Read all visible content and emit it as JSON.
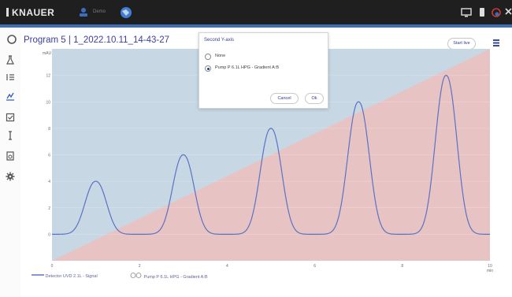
{
  "app": {
    "brand": "KNAUER",
    "user_label": "Demo"
  },
  "page": {
    "title": "Program 5 | 1_2022.10.11_14-43-27"
  },
  "toolbar": {
    "start_label": "Start live"
  },
  "dialog": {
    "title": "Second Y-axis",
    "options": [
      {
        "label": "None",
        "selected": false
      },
      {
        "label": "Pump P 6.1L HPG - Gradient A:B",
        "selected": true
      }
    ],
    "cancel_label": "Cancel",
    "ok_label": "Ok"
  },
  "legend": {
    "items": [
      {
        "label": "Detector UVD 2.1L - Signal",
        "color": "#5a72c4"
      },
      {
        "label": "Pump P 6.1L HPG - Gradient A:B",
        "color": "#e4b4b4"
      }
    ]
  },
  "chart_data": {
    "type": "line",
    "xunit": "min",
    "yunit": "mAU",
    "xlim": [
      0,
      10
    ],
    "ylim": [
      -2,
      14
    ],
    "xticks": [
      0,
      2,
      4,
      6,
      8,
      10
    ],
    "yticks": [
      0,
      2,
      4,
      6,
      8,
      10,
      12
    ],
    "series": [
      {
        "name": "Detector UVD 2.1L - Signal",
        "peaks": [
          {
            "center": 1.0,
            "height": 4.0
          },
          {
            "center": 3.0,
            "height": 6.0
          },
          {
            "center": 5.0,
            "height": 8.0
          },
          {
            "center": 7.0,
            "height": 10.0
          },
          {
            "center": 9.0,
            "height": 12.0
          }
        ],
        "baseline": 0
      },
      {
        "name": "Pump P 6.1L HPG - Gradient A:B",
        "x": [
          0,
          10
        ],
        "y": [
          0,
          100
        ],
        "unit": "%"
      }
    ],
    "colors": {
      "background": "#c7d7e4",
      "gradient_area": "#e8c3c4",
      "signal": "#5a72c4"
    }
  }
}
